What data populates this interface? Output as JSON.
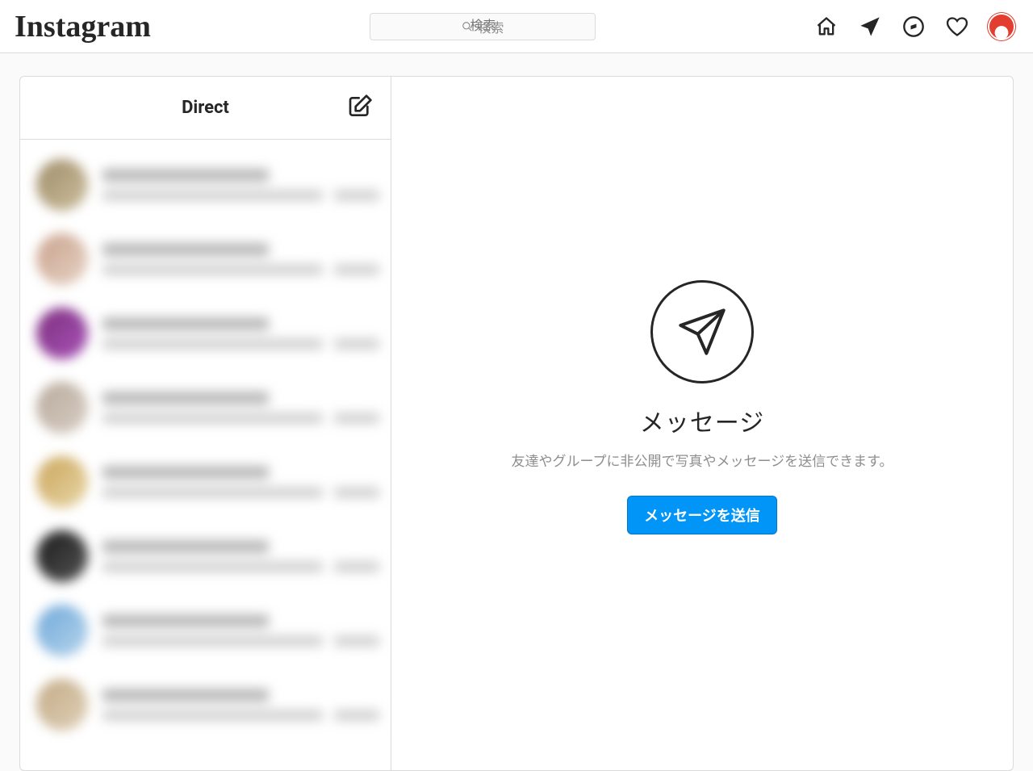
{
  "nav": {
    "brand": "Instagram",
    "search_placeholder": "検索",
    "icons": {
      "home": "home-icon",
      "messenger": "paper-plane-icon",
      "explore": "compass-icon",
      "activity": "heart-icon",
      "profile": "avatar"
    }
  },
  "sidebar": {
    "title": "Direct",
    "compose_icon": "compose-icon",
    "threads": [
      {
        "avatarClass": "av1"
      },
      {
        "avatarClass": "av2"
      },
      {
        "avatarClass": "av3"
      },
      {
        "avatarClass": "av4"
      },
      {
        "avatarClass": "av5"
      },
      {
        "avatarClass": "av6"
      },
      {
        "avatarClass": "av7"
      },
      {
        "avatarClass": "av8"
      }
    ]
  },
  "empty": {
    "title": "メッセージ",
    "description": "友達やグループに非公開で写真やメッセージを送信できます。",
    "button": "メッセージを送信"
  }
}
